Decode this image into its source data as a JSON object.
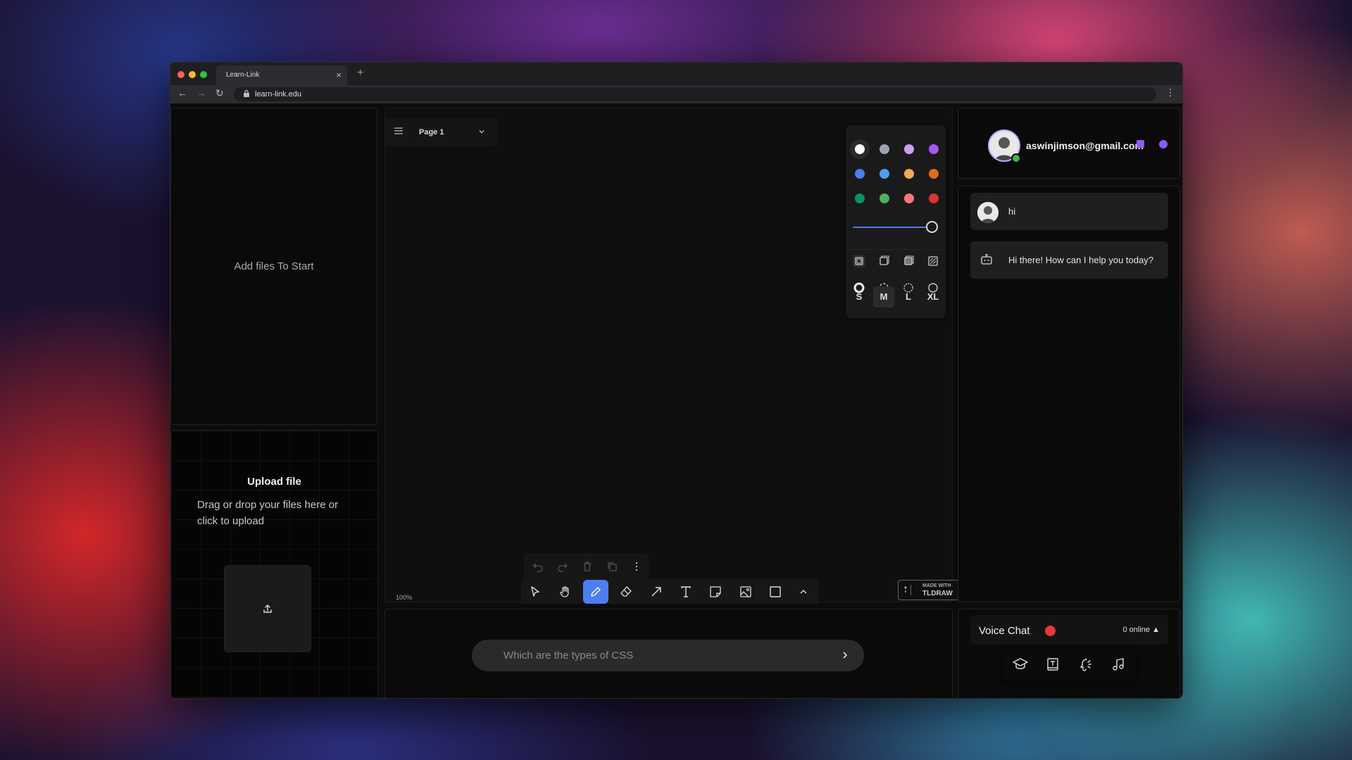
{
  "browser": {
    "tab_title": "Learn-Link",
    "tab_close": "×",
    "new_tab": "+",
    "url": "learn-link.edu",
    "back": "←",
    "forward": "→",
    "reload": "↻",
    "menu": "⋮",
    "traffic_colors": [
      "#ff5f57",
      "#febc2e",
      "#28c840"
    ]
  },
  "files_panel": {
    "empty_message": "Add files To Start"
  },
  "upload": {
    "title": "Upload file",
    "description": "Drag or drop your files here or click to upload"
  },
  "canvas": {
    "page_label": "Page 1",
    "zoom": "100%",
    "style_panel": {
      "colors": [
        "#ffffff",
        "#9ca3af",
        "#d19cf0",
        "#a855f7",
        "#4c7ef0",
        "#4ba1f1",
        "#f1ac4b",
        "#e16919",
        "#099268",
        "#4cb05e",
        "#f87777",
        "#e03131"
      ],
      "selected_color": "#ffffff",
      "opacity": 1.0,
      "fill_options": [
        "none-fill-icon",
        "semi-fill-icon",
        "solid-fill-icon",
        "pattern-fill-icon"
      ],
      "dash_options": [
        "draw-dash-icon",
        "dashed-icon",
        "dotted-icon",
        "solid-dash-icon"
      ],
      "sizes": [
        "S",
        "M",
        "L",
        "XL"
      ],
      "selected_size": "M"
    },
    "tools": [
      "select-icon",
      "hand-icon",
      "draw-icon",
      "eraser-icon",
      "arrow-icon",
      "text-icon",
      "note-icon",
      "image-icon",
      "rectangle-icon",
      "more-tools-icon"
    ],
    "active_tool": "draw-icon",
    "badge": {
      "line1": "MADE WITH",
      "line2": "TLDRAW"
    }
  },
  "prompt": {
    "placeholder": "Which are the types of CSS",
    "value": ""
  },
  "profile": {
    "email": "aswinjimson@gmail.com",
    "badge_color": "#8b5cf6"
  },
  "chat": {
    "messages": [
      {
        "sender": "user",
        "text": "hi"
      },
      {
        "sender": "bot",
        "text": "Hi there! How can I help you today?"
      }
    ]
  },
  "voice": {
    "title": "Voice Chat",
    "online": "0 online",
    "tools": [
      "graduation-cap-icon",
      "book-icon",
      "speech-icon",
      "music-icon"
    ]
  }
}
